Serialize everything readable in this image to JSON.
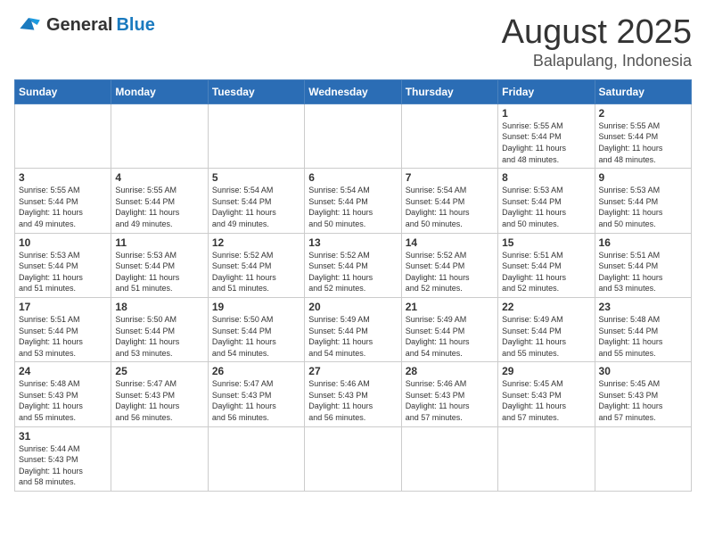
{
  "logo": {
    "general": "General",
    "blue": "Blue"
  },
  "title": {
    "month": "August 2025",
    "location": "Balapulang, Indonesia"
  },
  "weekdays": [
    "Sunday",
    "Monday",
    "Tuesday",
    "Wednesday",
    "Thursday",
    "Friday",
    "Saturday"
  ],
  "days": [
    {
      "date": "",
      "info": ""
    },
    {
      "date": "",
      "info": ""
    },
    {
      "date": "",
      "info": ""
    },
    {
      "date": "",
      "info": ""
    },
    {
      "date": "",
      "info": ""
    },
    {
      "date": "1",
      "info": "Sunrise: 5:55 AM\nSunset: 5:44 PM\nDaylight: 11 hours\nand 48 minutes."
    },
    {
      "date": "2",
      "info": "Sunrise: 5:55 AM\nSunset: 5:44 PM\nDaylight: 11 hours\nand 48 minutes."
    },
    {
      "date": "3",
      "info": "Sunrise: 5:55 AM\nSunset: 5:44 PM\nDaylight: 11 hours\nand 49 minutes."
    },
    {
      "date": "4",
      "info": "Sunrise: 5:55 AM\nSunset: 5:44 PM\nDaylight: 11 hours\nand 49 minutes."
    },
    {
      "date": "5",
      "info": "Sunrise: 5:54 AM\nSunset: 5:44 PM\nDaylight: 11 hours\nand 49 minutes."
    },
    {
      "date": "6",
      "info": "Sunrise: 5:54 AM\nSunset: 5:44 PM\nDaylight: 11 hours\nand 50 minutes."
    },
    {
      "date": "7",
      "info": "Sunrise: 5:54 AM\nSunset: 5:44 PM\nDaylight: 11 hours\nand 50 minutes."
    },
    {
      "date": "8",
      "info": "Sunrise: 5:53 AM\nSunset: 5:44 PM\nDaylight: 11 hours\nand 50 minutes."
    },
    {
      "date": "9",
      "info": "Sunrise: 5:53 AM\nSunset: 5:44 PM\nDaylight: 11 hours\nand 50 minutes."
    },
    {
      "date": "10",
      "info": "Sunrise: 5:53 AM\nSunset: 5:44 PM\nDaylight: 11 hours\nand 51 minutes."
    },
    {
      "date": "11",
      "info": "Sunrise: 5:53 AM\nSunset: 5:44 PM\nDaylight: 11 hours\nand 51 minutes."
    },
    {
      "date": "12",
      "info": "Sunrise: 5:52 AM\nSunset: 5:44 PM\nDaylight: 11 hours\nand 51 minutes."
    },
    {
      "date": "13",
      "info": "Sunrise: 5:52 AM\nSunset: 5:44 PM\nDaylight: 11 hours\nand 52 minutes."
    },
    {
      "date": "14",
      "info": "Sunrise: 5:52 AM\nSunset: 5:44 PM\nDaylight: 11 hours\nand 52 minutes."
    },
    {
      "date": "15",
      "info": "Sunrise: 5:51 AM\nSunset: 5:44 PM\nDaylight: 11 hours\nand 52 minutes."
    },
    {
      "date": "16",
      "info": "Sunrise: 5:51 AM\nSunset: 5:44 PM\nDaylight: 11 hours\nand 53 minutes."
    },
    {
      "date": "17",
      "info": "Sunrise: 5:51 AM\nSunset: 5:44 PM\nDaylight: 11 hours\nand 53 minutes."
    },
    {
      "date": "18",
      "info": "Sunrise: 5:50 AM\nSunset: 5:44 PM\nDaylight: 11 hours\nand 53 minutes."
    },
    {
      "date": "19",
      "info": "Sunrise: 5:50 AM\nSunset: 5:44 PM\nDaylight: 11 hours\nand 54 minutes."
    },
    {
      "date": "20",
      "info": "Sunrise: 5:49 AM\nSunset: 5:44 PM\nDaylight: 11 hours\nand 54 minutes."
    },
    {
      "date": "21",
      "info": "Sunrise: 5:49 AM\nSunset: 5:44 PM\nDaylight: 11 hours\nand 54 minutes."
    },
    {
      "date": "22",
      "info": "Sunrise: 5:49 AM\nSunset: 5:44 PM\nDaylight: 11 hours\nand 55 minutes."
    },
    {
      "date": "23",
      "info": "Sunrise: 5:48 AM\nSunset: 5:44 PM\nDaylight: 11 hours\nand 55 minutes."
    },
    {
      "date": "24",
      "info": "Sunrise: 5:48 AM\nSunset: 5:43 PM\nDaylight: 11 hours\nand 55 minutes."
    },
    {
      "date": "25",
      "info": "Sunrise: 5:47 AM\nSunset: 5:43 PM\nDaylight: 11 hours\nand 56 minutes."
    },
    {
      "date": "26",
      "info": "Sunrise: 5:47 AM\nSunset: 5:43 PM\nDaylight: 11 hours\nand 56 minutes."
    },
    {
      "date": "27",
      "info": "Sunrise: 5:46 AM\nSunset: 5:43 PM\nDaylight: 11 hours\nand 56 minutes."
    },
    {
      "date": "28",
      "info": "Sunrise: 5:46 AM\nSunset: 5:43 PM\nDaylight: 11 hours\nand 57 minutes."
    },
    {
      "date": "29",
      "info": "Sunrise: 5:45 AM\nSunset: 5:43 PM\nDaylight: 11 hours\nand 57 minutes."
    },
    {
      "date": "30",
      "info": "Sunrise: 5:45 AM\nSunset: 5:43 PM\nDaylight: 11 hours\nand 57 minutes."
    },
    {
      "date": "31",
      "info": "Sunrise: 5:44 AM\nSunset: 5:43 PM\nDaylight: 11 hours\nand 58 minutes."
    },
    {
      "date": "",
      "info": ""
    },
    {
      "date": "",
      "info": ""
    },
    {
      "date": "",
      "info": ""
    },
    {
      "date": "",
      "info": ""
    },
    {
      "date": "",
      "info": ""
    },
    {
      "date": "",
      "info": ""
    }
  ]
}
